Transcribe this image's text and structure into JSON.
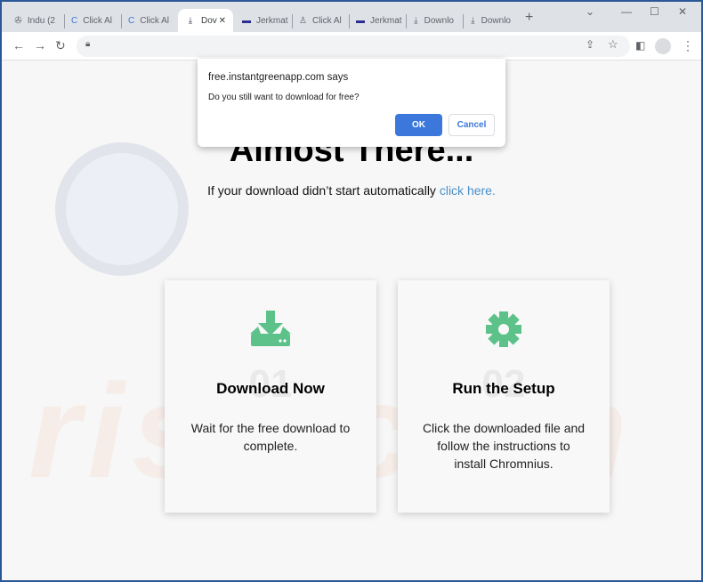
{
  "tabs": [
    {
      "label": "Indu (2",
      "icon": "film-reel-icon"
    },
    {
      "label": "Click Al",
      "icon": "c-logo-icon"
    },
    {
      "label": "Click Al",
      "icon": "c-logo-icon"
    },
    {
      "label": "Dov",
      "icon": "download-icon",
      "active": true
    },
    {
      "label": "Jerkmat",
      "icon": "pill-icon"
    },
    {
      "label": "Click Al",
      "icon": "person-icon"
    },
    {
      "label": "Jerkmat",
      "icon": "pill-icon"
    },
    {
      "label": "Downlo",
      "icon": "download-icon"
    },
    {
      "label": "Downlo",
      "icon": "download-icon"
    }
  ],
  "dialog": {
    "title": "free.instantgreenapp.com says",
    "message": "Do you still want to download for free?",
    "ok": "OK",
    "cancel": "Cancel"
  },
  "page": {
    "headline": "Almost There...",
    "sub": "If your download didn’t start automatically ",
    "link": "click here.",
    "cards": [
      {
        "num": "01",
        "title": "Download Now",
        "desc": "Wait for the free download to complete.",
        "icon": "download-drive-icon"
      },
      {
        "num": "02",
        "title": "Run the Setup",
        "desc": "Click the downloaded file and follow the instructions to install Chromnius.",
        "icon": "gear-icon"
      }
    ],
    "watermark": "risk.com"
  },
  "colors": {
    "accent": "#3c78dc",
    "icon_green": "#5cc28a",
    "link": "#4a90c8"
  }
}
